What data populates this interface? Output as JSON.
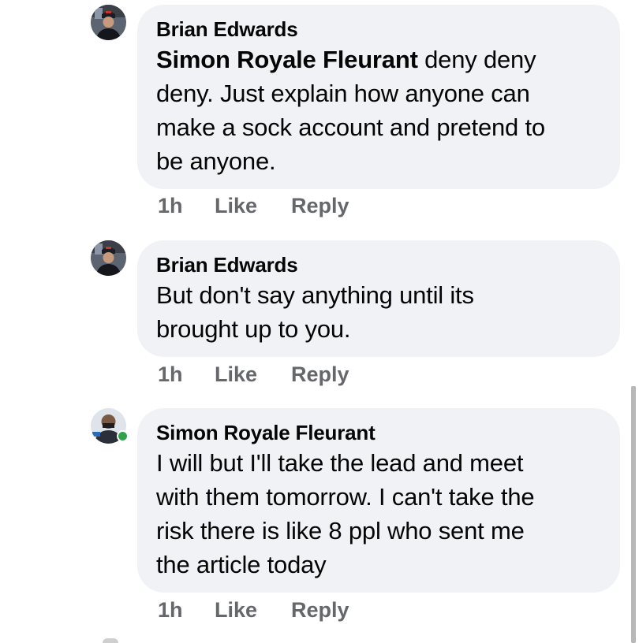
{
  "comments": [
    {
      "author": "Brian Edwards",
      "mention": "Simon Royale Fleurant",
      "lines": [
        "deny deny",
        "deny. Just explain how anyone can",
        "make a sock account and pretend to",
        "be anyone."
      ],
      "time": "1h",
      "like_label": "Like",
      "reply_label": "Reply",
      "avatar_icon": "profile-photo"
    },
    {
      "author": "Brian Edwards",
      "lines": [
        "But don't say anything until its",
        "brought up to you."
      ],
      "time": "1h",
      "like_label": "Like",
      "reply_label": "Reply",
      "avatar_icon": "profile-photo"
    },
    {
      "author": "Simon Royale Fleurant",
      "lines": [
        "I will but I'll take the lead and meet",
        "with them tomorrow. I can't take the",
        "risk there is like 8 ppl who sent me",
        "the article today"
      ],
      "time": "1h",
      "like_label": "Like",
      "reply_label": "Reply",
      "avatar_icon": "profile-photo",
      "online": true
    }
  ],
  "colors": {
    "bubble": "#f0f2f5",
    "meta_text": "#65676b",
    "online": "#31a24c"
  }
}
